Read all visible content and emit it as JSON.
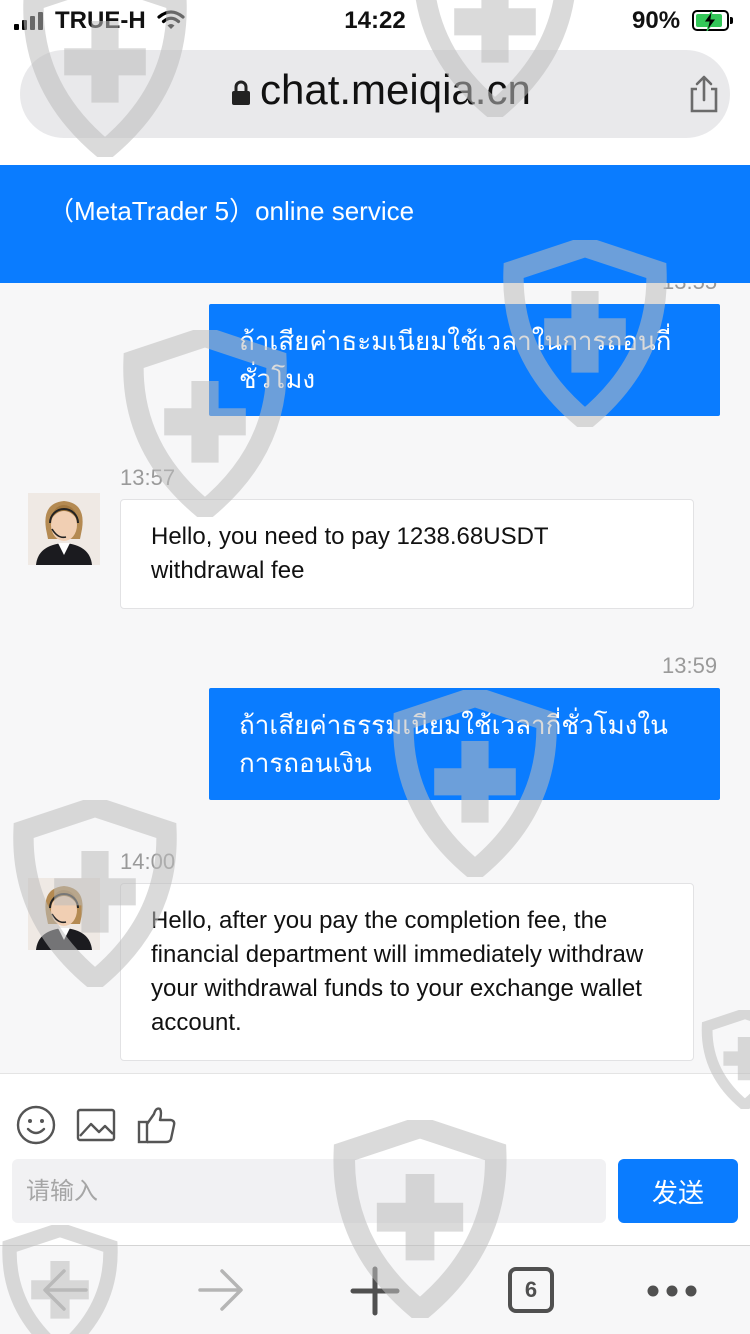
{
  "status_bar": {
    "carrier": "TRUE-H",
    "time": "14:22",
    "battery_percent": "90%",
    "battery_level": 0.9,
    "charging": true
  },
  "browser": {
    "url": "chat.meiqia.cn",
    "open_tabs": "6",
    "icons": [
      "lock-icon",
      "share-icon",
      "back-arrow-icon",
      "forward-arrow-icon",
      "new-tab-plus-icon",
      "more-dots-icon"
    ]
  },
  "chat": {
    "title": "（MetaTrader 5）online service",
    "partial_timestamp": "13:55",
    "messages": [
      {
        "direction": "out",
        "text": "ถ้าเสียค่าธะมเนียมใช้เวลาในการถอนกี่ชั่วโมง"
      },
      {
        "direction": "in",
        "timestamp": "13:57",
        "text": "Hello, you need to pay 1238.68USDT withdrawal fee"
      },
      {
        "direction": "out",
        "timestamp": "13:59",
        "text": "ถ้าเสียค่าธรรมเนียมใช้เวลากี่ชั่วโมงในการถอนเงิน"
      },
      {
        "direction": "in",
        "timestamp": "14:00",
        "text": "Hello, after you pay the completion fee, the financial department will immediately withdraw your withdrawal funds to your exchange wallet account."
      }
    ]
  },
  "composer": {
    "placeholder": "请输入",
    "send_label": "发送",
    "tools": [
      "emoji-icon",
      "image-icon",
      "thumbs-up-icon"
    ]
  },
  "colors": {
    "accent": "#0a7cff",
    "message_area_bg": "#f7f7f8",
    "watermark": "#bdbdbd"
  }
}
